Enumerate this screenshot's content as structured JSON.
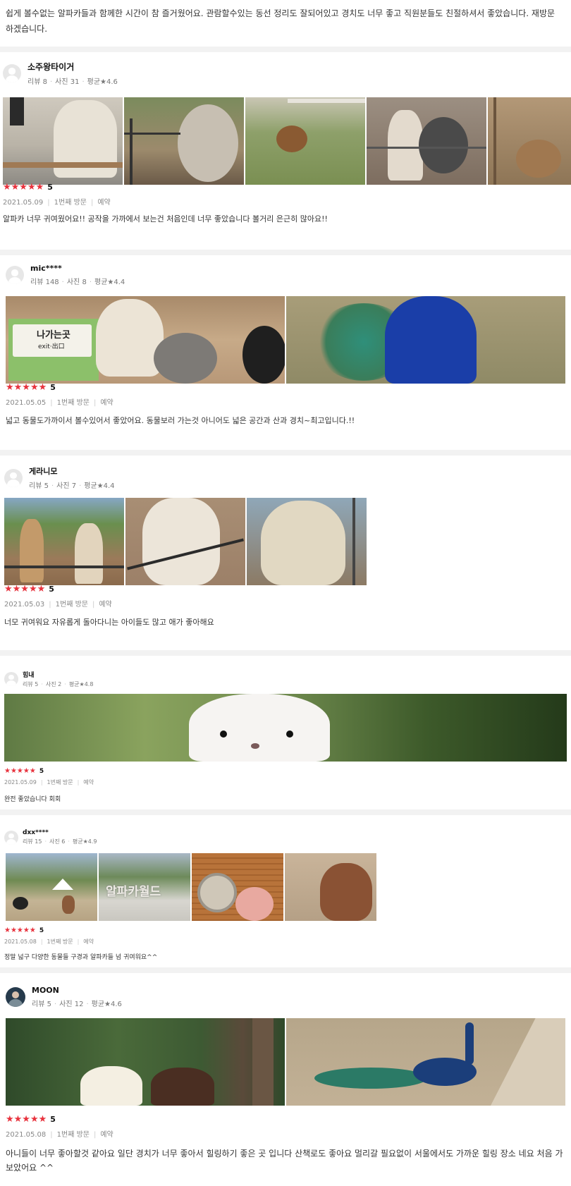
{
  "reviews": [
    {
      "text": "쉽게 볼수없는 알파카들과 함께한 시간이 참 즐거웠어요. 관람할수있는 동선 정리도 잘되어있고 경치도 너무 좋고 직원분들도 친절하셔서 좋았습니다. 재방문하겠습니다."
    },
    {
      "nickname": "소주왕타이거",
      "stats": [
        "리뷰 8",
        "사진 31",
        "평균★4.6"
      ],
      "stars": "★★★★★",
      "rating": "5",
      "meta": [
        "2021.05.09",
        "1번째 방문",
        "예약"
      ],
      "text": "알파카 너무 귀여웠어요!! 공작을 가까에서 보는건 처음인데 너무 좋았습니다 볼거리 은근히 많아요!!"
    },
    {
      "nickname": "mic****",
      "stats": [
        "리뷰 148",
        "사진 8",
        "평균★4.4"
      ],
      "stars": "★★★★★",
      "rating": "5",
      "meta": [
        "2021.05.05",
        "1번째 방문",
        "예약"
      ],
      "photo_sign": [
        "나가는곳",
        "exit·出口"
      ],
      "text": "넓고 동물도가까이서 볼수있어서 좋았어요. 동물보러 가는것 아니어도 넓은 공간과 산과 경치~최고입니다.!!"
    },
    {
      "nickname": "게라니모",
      "stats": [
        "리뷰 5",
        "사진 7",
        "평균★4.4"
      ],
      "stars": "★★★★★",
      "rating": "5",
      "meta": [
        "2021.05.03",
        "1번째 방문",
        "예약"
      ],
      "text": "너모 귀여워요 자유롭게 돌아다니는 아이들도 많고 애가 좋아해요"
    },
    {
      "nickname": "힘내",
      "stats": [
        "리뷰 5",
        "사진 2",
        "평균★4.8"
      ],
      "stars": "★★★★★",
      "rating": "5",
      "meta": [
        "2021.05.09",
        "1번째 방문",
        "예약"
      ],
      "text": "완전 좋았습니다 회회"
    },
    {
      "nickname": "dxx****",
      "stats": [
        "리뷰 15",
        "사진 6",
        "평균★4.9"
      ],
      "stars": "★★★★★",
      "rating": "5",
      "meta": [
        "2021.05.08",
        "1번째 방문",
        "예약"
      ],
      "photo_sign": "알파카월드",
      "text": "정말 넓구 다양한 동물들 구경과 알파카들 넘 귀여워요^^"
    },
    {
      "nickname": "MOON",
      "stats": [
        "리뷰 5",
        "사진 12",
        "평균★4.6"
      ],
      "stars": "★★★★★",
      "rating": "5",
      "meta": [
        "2021.05.08",
        "1번째 방문",
        "예약"
      ],
      "text": "아니들이 너무 좋아할것 같아요 일단 경치가 너무 좋아서 힐링하기 좋은 곳 입니다 산책로도 좋아요 멀리갈 필요없이 서울에서도 가까운 힐링 장소 네요 처음 가보았어요 ^^"
    }
  ]
}
